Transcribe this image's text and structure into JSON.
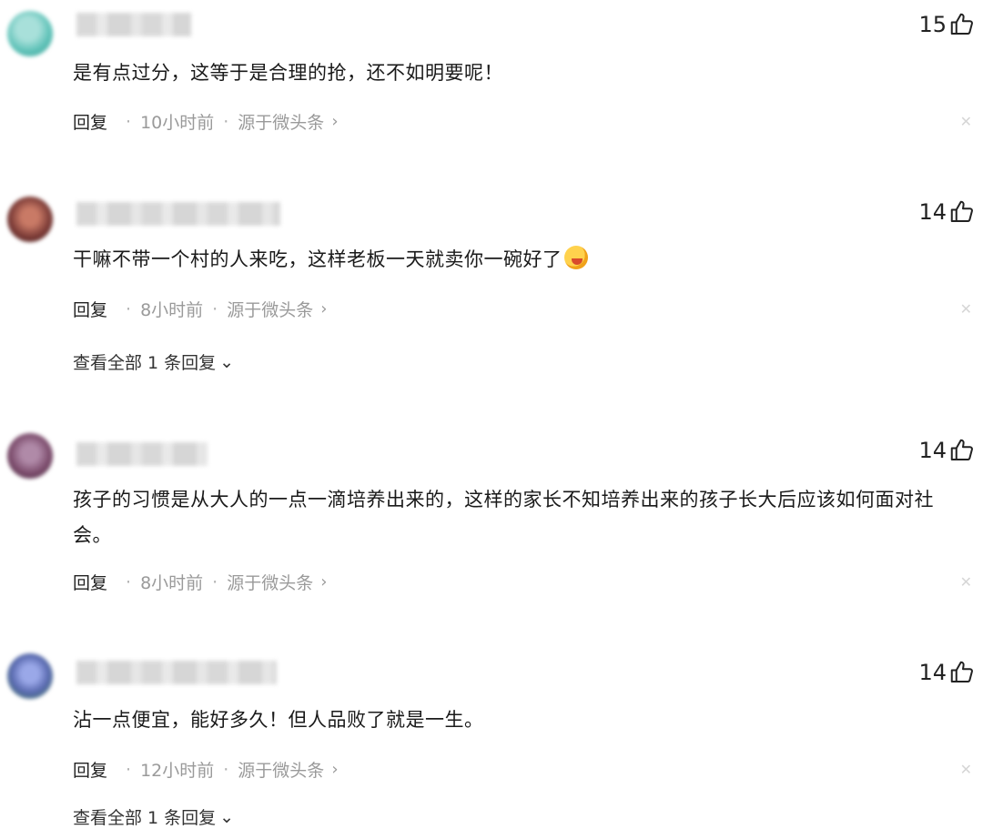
{
  "comments": [
    {
      "likes": "15",
      "text": "是有点过分，这等于是合理的抢，还不如明要呢！",
      "reply_label": "回复",
      "time": "10小时前",
      "source": "源于微头条",
      "avatar_color": "#5fc2b8"
    },
    {
      "likes": "14",
      "text": "干嘛不带一个村的人来吃，这样老板一天就卖你一碗好了",
      "reply_label": "回复",
      "time": "8小时前",
      "source": "源于微头条",
      "view_all": "查看全部 1 条回复",
      "avatar_color": "#7a3a36"
    },
    {
      "likes": "14",
      "text": "孩子的习惯是从大人的一点一滴培养出来的，这样的家长不知培养出来的孩子长大后应该如何面对社会。",
      "reply_label": "回复",
      "time": "8小时前",
      "source": "源于微头条",
      "avatar_color": "#7a4a6a"
    },
    {
      "likes": "14",
      "text": "沾一点便宜，能好多久！但人品败了就是一生。",
      "reply_label": "回复",
      "time": "12小时前",
      "source": "源于微头条",
      "view_all": "查看全部 1 条回复",
      "avatar_color": "#5a6ab0"
    }
  ],
  "icons": {
    "like": "thumbs-up-icon",
    "chevron_right": "chevron-right-icon",
    "chevron_down": "chevron-down-icon",
    "close": "close-icon"
  },
  "colors": {
    "meta_text": "#9a9a9a",
    "body_text": "#1a1a1a"
  }
}
